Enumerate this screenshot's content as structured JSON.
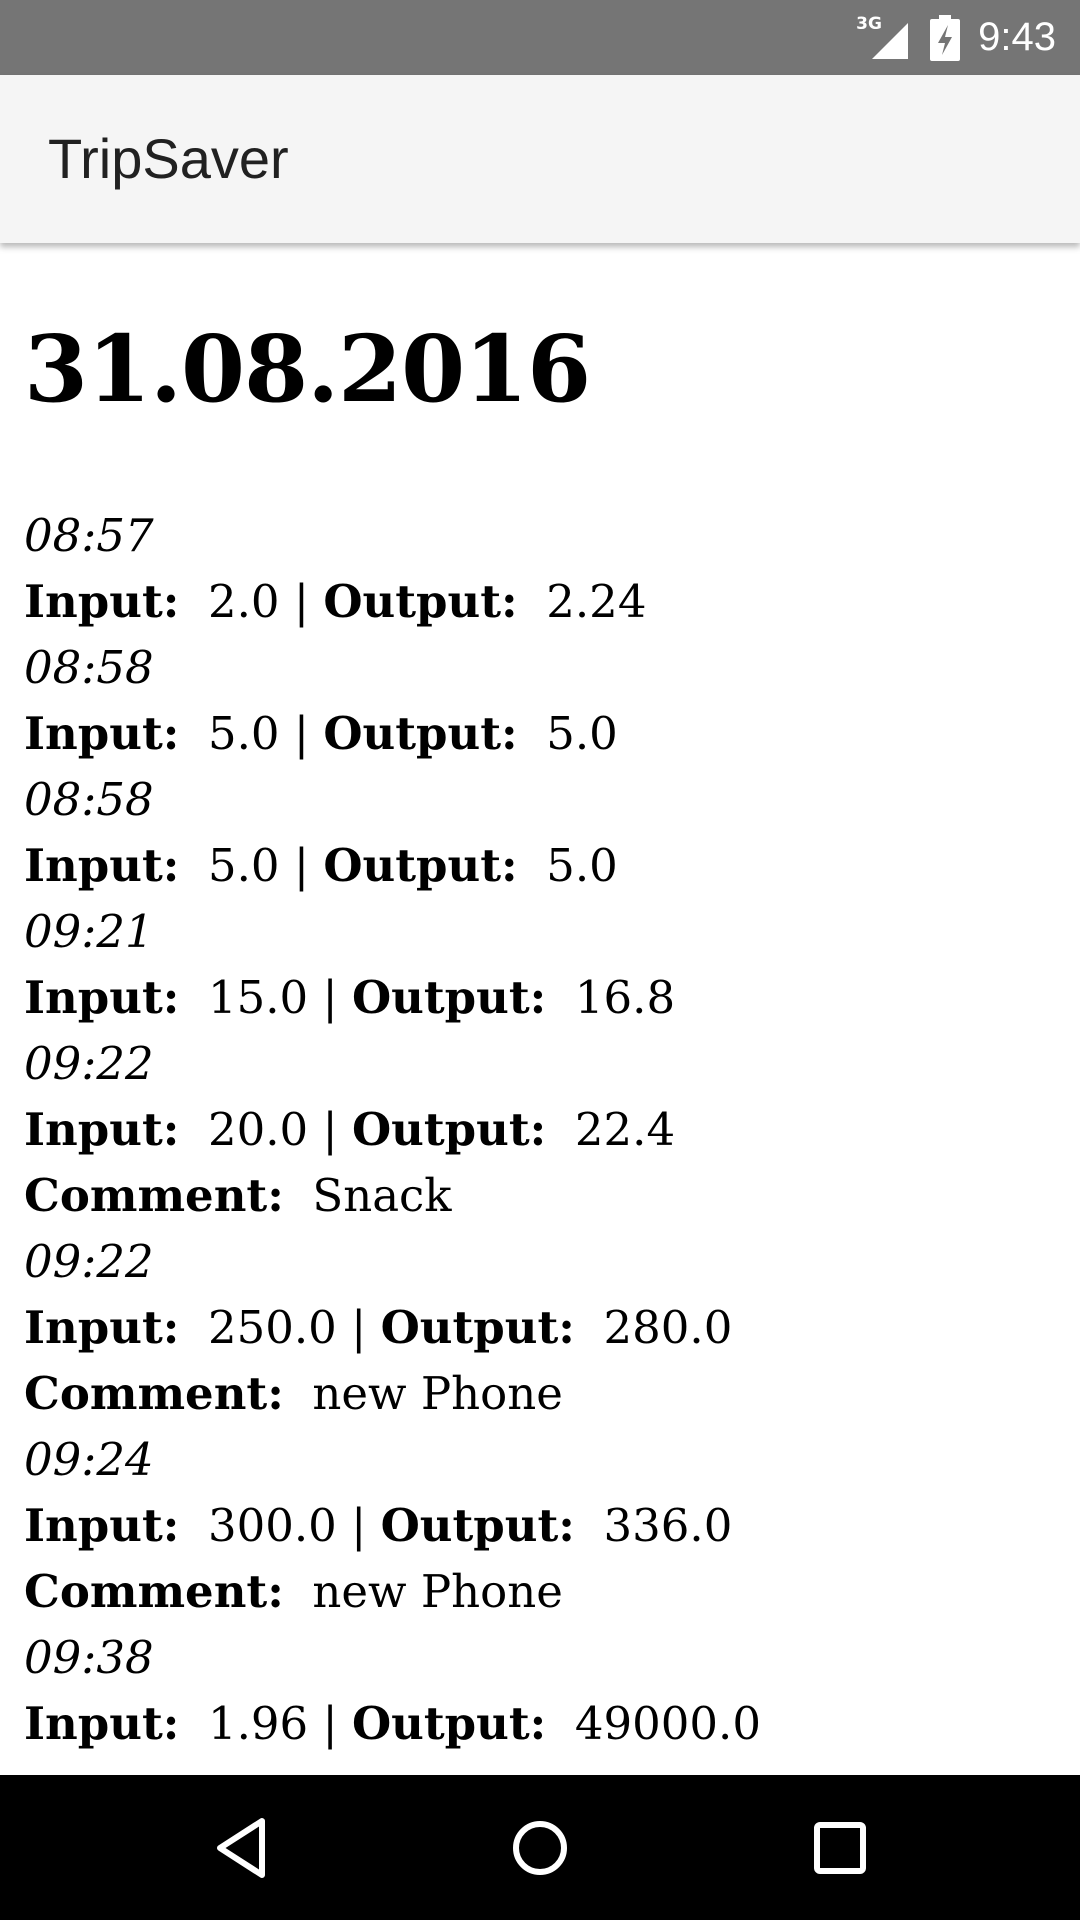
{
  "status_bar": {
    "network_type": "3G",
    "clock": "9:43",
    "icons": [
      "signal-icon",
      "battery-charging-icon"
    ]
  },
  "app_bar": {
    "title": "TripSaver"
  },
  "content": {
    "date": "31.08.2016",
    "input_label": "Input:",
    "output_label": "Output:",
    "comment_label": "Comment:",
    "separator": "|",
    "entries": [
      {
        "time": "08:57",
        "input": "2.0",
        "output": "2.24"
      },
      {
        "time": "08:58",
        "input": "5.0",
        "output": "5.0"
      },
      {
        "time": "08:58",
        "input": "5.0",
        "output": "5.0"
      },
      {
        "time": "09:21",
        "input": "15.0",
        "output": "16.8"
      },
      {
        "time": "09:22",
        "input": "20.0",
        "output": "22.4",
        "comment": "Snack"
      },
      {
        "time": "09:22",
        "input": "250.0",
        "output": "280.0",
        "comment": "new Phone"
      },
      {
        "time": "09:24",
        "input": "300.0",
        "output": "336.0",
        "comment": "new Phone"
      },
      {
        "time": "09:38",
        "input": "1.96",
        "output": "49000.0"
      }
    ]
  },
  "nav_bar": {
    "icons": [
      "back-icon",
      "home-icon",
      "recents-icon"
    ]
  }
}
